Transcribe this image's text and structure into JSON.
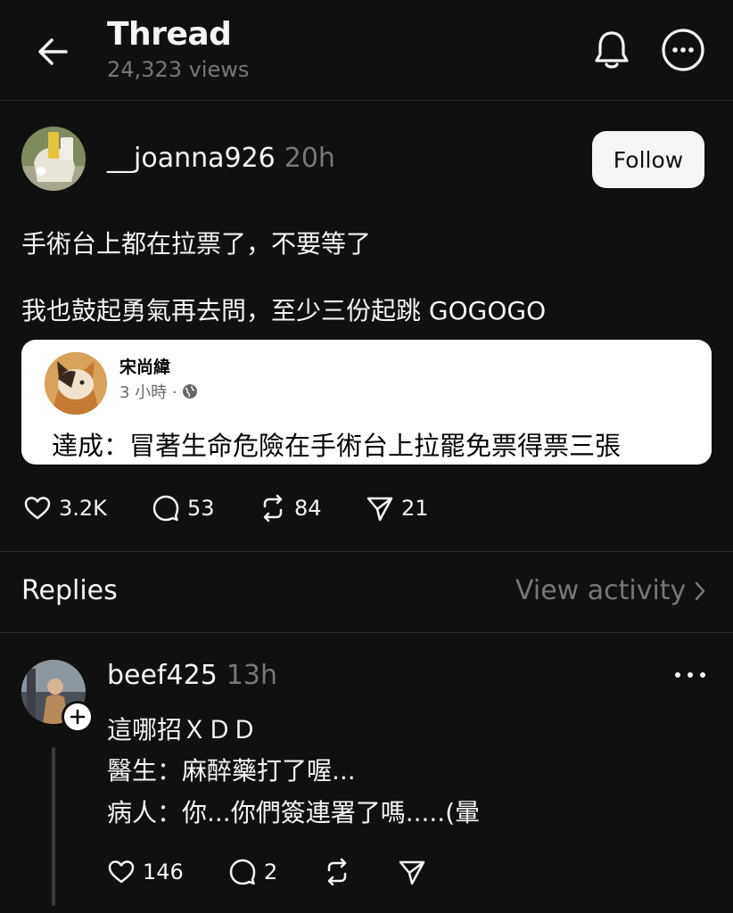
{
  "header": {
    "title": "Thread",
    "views": "24,323 views"
  },
  "post": {
    "username": "__joanna926",
    "time": "20h",
    "follow_label": "Follow",
    "text_lines": [
      "手術台上都在拉票了，不要等了",
      "我也鼓起勇氣再去問，至少三份起跳 GOGOGO"
    ],
    "embed": {
      "name": "宋尚緯",
      "time": "3 小時 ·",
      "body": "達成：冒著生命危險在手術台上拉罷免票得票三張"
    },
    "actions": {
      "likes": "3.2K",
      "comments": "53",
      "reposts": "84",
      "shares": "21"
    }
  },
  "replies_section": {
    "label": "Replies",
    "view_activity": "View activity"
  },
  "reply": {
    "username": "beef425",
    "time": "13h",
    "lines": [
      "這哪招ＸＤＤ",
      "醫生：麻醉藥打了喔...",
      "病人：你...你們簽連署了嗎.....(暈"
    ],
    "actions": {
      "likes": "146",
      "comments": "2"
    }
  },
  "icons": {
    "back": "arrow-left-icon",
    "bell": "bell-icon",
    "more": "more-horizontal-icon",
    "heart": "heart-icon",
    "comment": "comment-icon",
    "repost": "repost-icon",
    "share": "send-icon",
    "globe": "globe-icon",
    "plus": "plus-icon",
    "chevron": "chevron-right-icon"
  },
  "colors": {
    "background": "#101010",
    "text": "#f3f5f7",
    "muted": "#777777",
    "divider": "#2b2b2b",
    "follow_bg": "#f3f5f7"
  }
}
